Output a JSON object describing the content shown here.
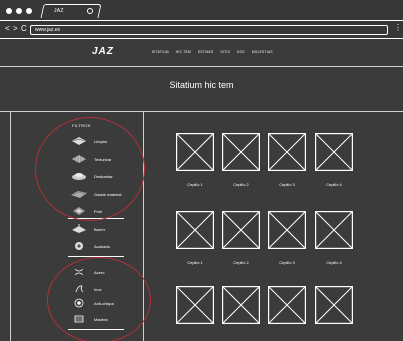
{
  "browser": {
    "tab_title": "JAZ",
    "url": "www.jaz.es",
    "back": "<",
    "forward": ">",
    "reload": "C",
    "menu": "⋮"
  },
  "site": {
    "brand": "JAZ",
    "nav": [
      "SITATIUM",
      "HIC TEM",
      "ESTIAES",
      "SITIS",
      "DOS",
      "MOLESTIAS"
    ],
    "hero_title": "Sitatium hic tem"
  },
  "sidebar": {
    "title": "FILTROS",
    "filters": [
      {
        "label": "Limpiar",
        "icon": "cleaning-brush-icon"
      },
      {
        "label": "Texturizar",
        "icon": "texturing-brush-icon"
      },
      {
        "label": "Desbarbar",
        "icon": "deburring-brush-icon"
      },
      {
        "label": "Gastar material",
        "icon": "material-removal-brush-icon"
      },
      {
        "label": "Pulir",
        "icon": "polishing-brush-icon"
      },
      {
        "label": "Barrer",
        "icon": "sweeping-brush-icon"
      },
      {
        "label": "Acabado",
        "icon": "finishing-brush-icon"
      }
    ],
    "materials": [
      {
        "label": "Acero",
        "icon": "steel-wire-icon"
      },
      {
        "label": "Inox",
        "icon": "stainless-wire-icon"
      },
      {
        "label": "Anti-chispa",
        "icon": "anti-spark-icon"
      },
      {
        "label": "Madera",
        "icon": "wood-icon"
      }
    ]
  },
  "products": {
    "row1": [
      "Cepillo 1",
      "Cepillo 2",
      "Cepillo 3",
      "Cepillo 4"
    ],
    "row2": [
      "Cepillo 1",
      "Cepillo 2",
      "Cepillo 3",
      "Cepillo 4"
    ],
    "row3": [
      "",
      "",
      "",
      ""
    ]
  },
  "colors": {
    "background": "#3b3b3b",
    "annotation_circle": "#b2303a",
    "foreground": "#ffffff"
  }
}
